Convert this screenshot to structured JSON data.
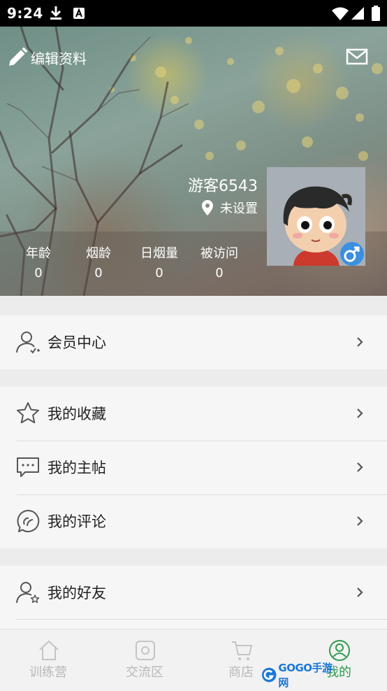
{
  "status_bar": {
    "time": "9:24"
  },
  "header": {
    "edit_label": "编辑资料",
    "username": "游客6543",
    "location": "未设置",
    "stats": [
      {
        "label": "年龄",
        "value": "0"
      },
      {
        "label": "烟龄",
        "value": "0"
      },
      {
        "label": "日烟量",
        "value": "0"
      },
      {
        "label": "被访问",
        "value": "0"
      }
    ]
  },
  "menu": {
    "member_center": "会员中心",
    "favorites": "我的收藏",
    "my_posts": "我的主帖",
    "my_comments": "我的评论",
    "my_friends": "我的好友"
  },
  "bottom_nav": {
    "items": [
      {
        "label": "训练营",
        "icon": "house-icon",
        "active": false
      },
      {
        "label": "交流区",
        "icon": "chat-square-icon",
        "active": false
      },
      {
        "label": "商店",
        "icon": "cart-icon",
        "active": false
      },
      {
        "label": "我的",
        "icon": "user-circle-icon",
        "active": true
      }
    ]
  },
  "watermark": {
    "text": "GOGO手游网"
  },
  "colors": {
    "active_tab": "#2e9a4e",
    "inactive_tab": "#b8b8b8",
    "gender_badge": "#3b8fe0"
  }
}
